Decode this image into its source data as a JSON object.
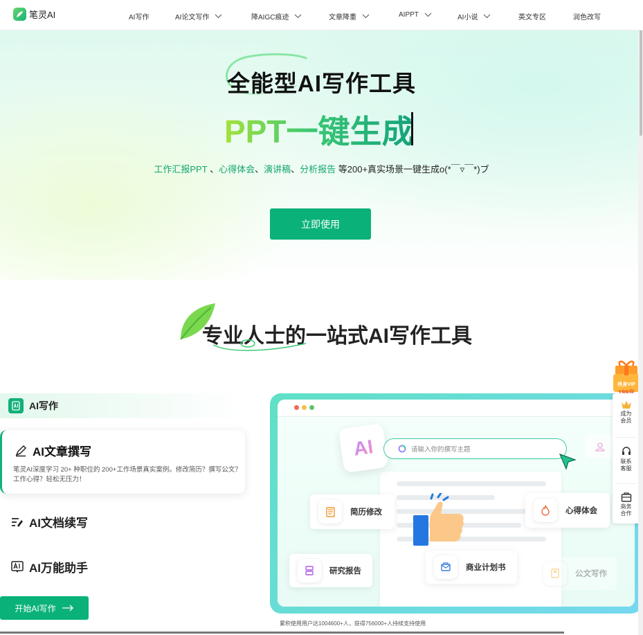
{
  "nav": {
    "logo_text": "笔灵AI",
    "items": [
      {
        "label": "AI写作",
        "dropdown": false
      },
      {
        "label": "AI论文写作",
        "dropdown": true
      },
      {
        "label": "降AIGC痕迹",
        "dropdown": true
      },
      {
        "label": "文章降重",
        "dropdown": true
      },
      {
        "label": "AIPPT",
        "dropdown": true
      },
      {
        "label": "AI小说",
        "dropdown": true
      },
      {
        "label": "英文专区",
        "dropdown": false
      },
      {
        "label": "润色改写",
        "dropdown": false
      }
    ]
  },
  "hero": {
    "title": "全能型AI写作工具",
    "subtitle": "PPT一键生成",
    "desc_h1": "工作汇报PPT",
    "desc_sep1": " 、",
    "desc_h2": "心得体会",
    "desc_sep2": "、",
    "desc_h3": "演讲稿",
    "desc_sep3": "、",
    "desc_h4": "分析报告",
    "desc_tail": " 等200+真实场景一键生成o(*￣▿￣*)ブ",
    "cta": "立即使用"
  },
  "section": {
    "title": "专业人士的一站式AI写作工具"
  },
  "left_panel": {
    "category": "AI写作",
    "active": {
      "title": "AI文章撰写",
      "desc": "笔灵AI深度学习 20+ 种职位的 200+工作场景真实案例。修改简历？撰写公文？工作心得？轻松无压力！"
    },
    "features": [
      "AI文档续写",
      "AI万能助手"
    ],
    "start_button": "开始AI写作"
  },
  "mockup": {
    "ai_badge": "AI",
    "search_placeholder": "请输入你的撰写主题",
    "chips": [
      "简历修改",
      "心得体会",
      "研究报告",
      "商业计划书",
      "公文写作"
    ],
    "caption": "累积使用用户达1004600+人，获得756000+人持续支持使用"
  },
  "sidebar": {
    "vip_label": "终身VIP",
    "vip_price": "199元",
    "items": [
      "成为会员",
      "联系客服",
      "商务合作"
    ]
  },
  "colors": {
    "brand": "#0ab27a",
    "gradient_start": "#a6e23a",
    "gradient_end": "#13a27c"
  }
}
